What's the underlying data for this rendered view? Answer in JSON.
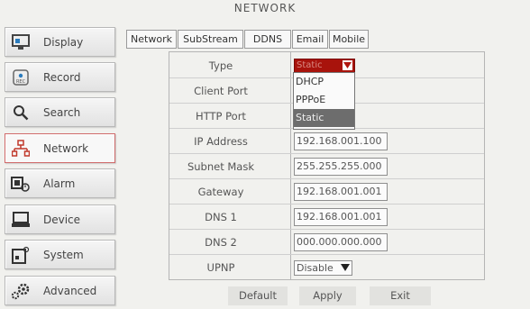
{
  "window": {
    "title": "NETWORK"
  },
  "sidebar": {
    "items": [
      {
        "label": "Display",
        "icon": "display-icon"
      },
      {
        "label": "Record",
        "icon": "record-icon"
      },
      {
        "label": "Search",
        "icon": "search-icon"
      },
      {
        "label": "Network",
        "icon": "network-icon",
        "active": true
      },
      {
        "label": "Alarm",
        "icon": "alarm-icon"
      },
      {
        "label": "Device",
        "icon": "device-icon"
      },
      {
        "label": "System",
        "icon": "system-icon"
      },
      {
        "label": "Advanced",
        "icon": "advanced-icon"
      }
    ]
  },
  "tabs": [
    {
      "label": "Network",
      "active": true
    },
    {
      "label": "SubStream"
    },
    {
      "label": "DDNS"
    },
    {
      "label": "Email"
    },
    {
      "label": "Mobile"
    }
  ],
  "form": {
    "type": {
      "label": "Type",
      "value": "Static",
      "options": [
        "DHCP",
        "PPPoE",
        "Static"
      ]
    },
    "client_port": {
      "label": "Client Port"
    },
    "http_port": {
      "label": "HTTP Port"
    },
    "ip_address": {
      "label": "IP Address",
      "value": "192.168.001.100"
    },
    "subnet_mask": {
      "label": "Subnet Mask",
      "value": "255.255.255.000"
    },
    "gateway": {
      "label": "Gateway",
      "value": "192.168.001.001"
    },
    "dns1": {
      "label": "DNS 1",
      "value": "192.168.001.001"
    },
    "dns2": {
      "label": "DNS 2",
      "value": "000.000.000.000"
    },
    "upnp": {
      "label": "UPNP",
      "value": "Disable"
    }
  },
  "buttons": {
    "default": "Default",
    "apply": "Apply",
    "exit": "Exit"
  },
  "colors": {
    "accent_red": "#a8130c",
    "active_border": "#d06b6b",
    "selected_option": "#6d6d6d"
  }
}
